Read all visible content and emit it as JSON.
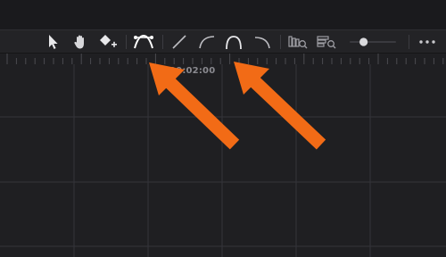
{
  "toolbar": {
    "tools": [
      {
        "name": "pointer-tool",
        "icon": "cursor-arrow-icon"
      },
      {
        "name": "hand-tool",
        "icon": "hand-icon"
      },
      {
        "name": "add-keyframe-tool",
        "icon": "diamond-plus-icon"
      },
      {
        "name": "bezier-handles-tool",
        "icon": "bezier-curve-icon",
        "active": true
      },
      {
        "name": "linear-interpolation",
        "icon": "linear-line-icon"
      },
      {
        "name": "ease-in-interpolation",
        "icon": "ease-in-curve-icon"
      },
      {
        "name": "ease-in-out-interpolation",
        "icon": "ease-in-out-curve-icon"
      },
      {
        "name": "ease-out-interpolation",
        "icon": "ease-out-curve-icon"
      },
      {
        "name": "zoom-to-fit-horizontal",
        "icon": "zoom-fit-h-icon"
      },
      {
        "name": "zoom-to-fit-vertical",
        "icon": "zoom-fit-v-icon"
      },
      {
        "name": "zoom-slider",
        "icon": "slider-icon"
      },
      {
        "name": "more-options",
        "icon": "ellipsis-icon"
      }
    ],
    "zoom_level": 0.3
  },
  "ruler": {
    "timecode": "00:02:00"
  },
  "annotation": {
    "arrow_color": "#f26b16"
  }
}
